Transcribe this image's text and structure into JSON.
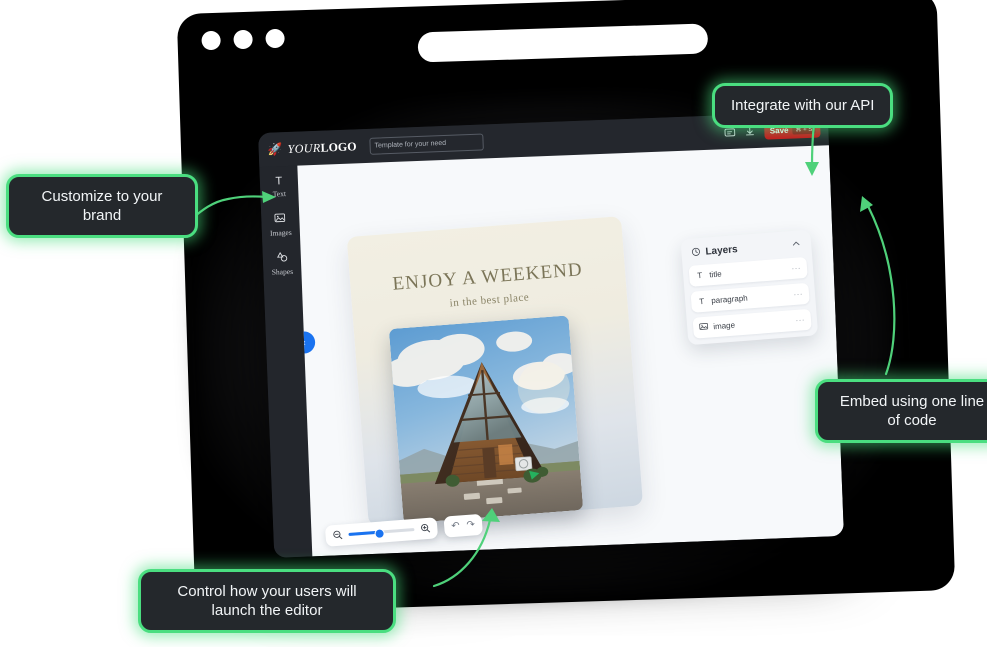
{
  "browser": {
    "traffic_lights": [
      "red",
      "yellow",
      "green"
    ],
    "url_bar_value": ""
  },
  "editor": {
    "logo": {
      "icon": "rocket-icon",
      "text_light": "YOUR",
      "text_bold": "LOGO"
    },
    "template_input": {
      "placeholder": "Template for your need",
      "value": ""
    },
    "toolbar": {
      "comment_icon": "comment-icon",
      "download_icon": "download-icon",
      "save_label": "Save",
      "save_shortcut": "⌘ + S",
      "save_color": "#cc1118"
    },
    "tools": [
      {
        "icon": "text-icon",
        "glyph": "T",
        "label": "Text"
      },
      {
        "icon": "image-icon",
        "glyph": "Ὓc",
        "label": "Images"
      },
      {
        "icon": "shapes-icon",
        "glyph": "△",
        "label": "Shapes"
      }
    ],
    "collapse_button": {
      "icon": "chevron-left-icon",
      "glyph": "‹",
      "color": "#1a73f0"
    },
    "poster": {
      "title": "ENJOY A WEEKEND",
      "subtitle": "in the best place",
      "image_alt": "A-frame wooden cabin under a cloudy blue sky"
    },
    "layers_panel": {
      "header_icon": "clock-icon",
      "title": "Layers",
      "collapse_icon": "chevron-up-icon",
      "rows": [
        {
          "icon": "text-icon",
          "glyph": "T",
          "name": "title",
          "menu": "···"
        },
        {
          "icon": "text-icon",
          "glyph": "T",
          "name": "paragraph",
          "menu": "···"
        },
        {
          "icon": "image-icon",
          "glyph": "⬚",
          "name": "image",
          "menu": "···"
        }
      ]
    },
    "zoom_toolbar": {
      "zoom_out_icon": "zoom-out-icon",
      "zoom_in_icon": "zoom-in-icon",
      "slider_percent": 45,
      "slider_color": "#1a73f0",
      "undo_icon": "undo-icon",
      "undo_glyph": "↶",
      "redo_icon": "redo-icon",
      "redo_glyph": "↷"
    }
  },
  "callouts": {
    "customize": "Customize to your brand",
    "api": "Integrate with our API",
    "embed": "Embed using one line of code",
    "control": "Control how your users will launch the editor",
    "border_color": "#4ade80",
    "background": "#24282c"
  }
}
